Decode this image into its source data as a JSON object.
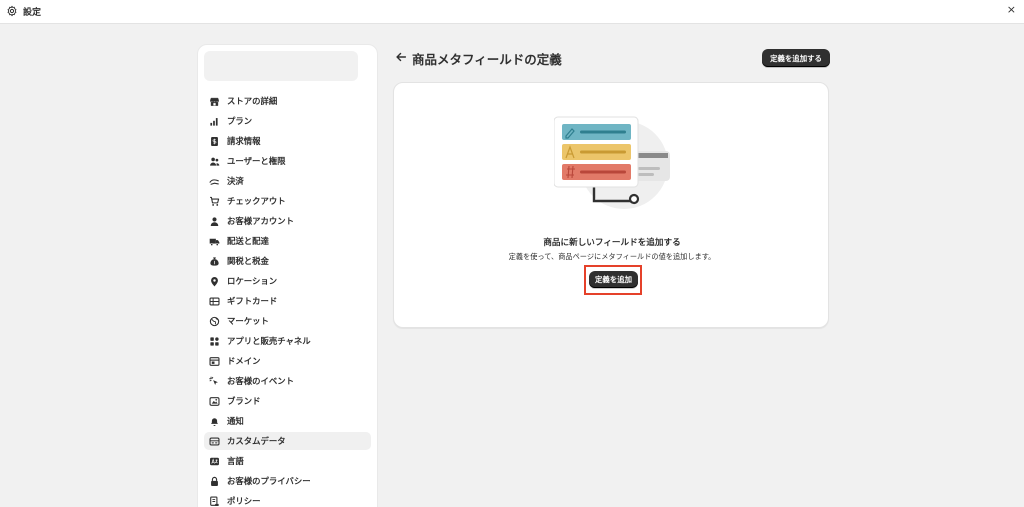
{
  "window": {
    "title": "設定",
    "close_label": "×"
  },
  "sidebar": {
    "items": [
      {
        "label": "ストアの詳細",
        "icon": "store-icon",
        "active": false
      },
      {
        "label": "プラン",
        "icon": "plan-icon",
        "active": false
      },
      {
        "label": "請求情報",
        "icon": "billing-icon",
        "active": false
      },
      {
        "label": "ユーザーと権限",
        "icon": "users-icon",
        "active": false
      },
      {
        "label": "決済",
        "icon": "payments-icon",
        "active": false
      },
      {
        "label": "チェックアウト",
        "icon": "cart-icon",
        "active": false
      },
      {
        "label": "お客様アカウント",
        "icon": "person-icon",
        "active": false
      },
      {
        "label": "配送と配達",
        "icon": "truck-icon",
        "active": false
      },
      {
        "label": "関税と税金",
        "icon": "money-bag-icon",
        "active": false
      },
      {
        "label": "ロケーション",
        "icon": "location-pin-icon",
        "active": false
      },
      {
        "label": "ギフトカード",
        "icon": "gift-card-icon",
        "active": false
      },
      {
        "label": "マーケット",
        "icon": "globe-icon",
        "active": false
      },
      {
        "label": "アプリと販売チャネル",
        "icon": "apps-icon",
        "active": false
      },
      {
        "label": "ドメイン",
        "icon": "domain-icon",
        "active": false
      },
      {
        "label": "お客様のイベント",
        "icon": "cursor-click-icon",
        "active": false
      },
      {
        "label": "ブランド",
        "icon": "brand-icon",
        "active": false
      },
      {
        "label": "通知",
        "icon": "bell-icon",
        "active": false
      },
      {
        "label": "カスタムデータ",
        "icon": "custom-data-icon",
        "active": true
      },
      {
        "label": "言語",
        "icon": "language-icon",
        "active": false
      },
      {
        "label": "お客様のプライバシー",
        "icon": "lock-icon",
        "active": false
      },
      {
        "label": "ポリシー",
        "icon": "policy-icon",
        "active": false
      }
    ]
  },
  "header": {
    "title": "商品メタフィールドの定義",
    "add_definition_button": "定義を追加する"
  },
  "empty_state": {
    "heading": "商品に新しいフィールドを追加する",
    "description": "定義を使って、商品ページにメタフィールドの値を追加します。",
    "add_button": "定義を追加"
  },
  "colors": {
    "highlight_border": "#e5412a",
    "button_dark": "#303030",
    "illustration_teal": "#6fb5c4",
    "illustration_yellow": "#ecc56a",
    "illustration_red": "#e27a68"
  }
}
